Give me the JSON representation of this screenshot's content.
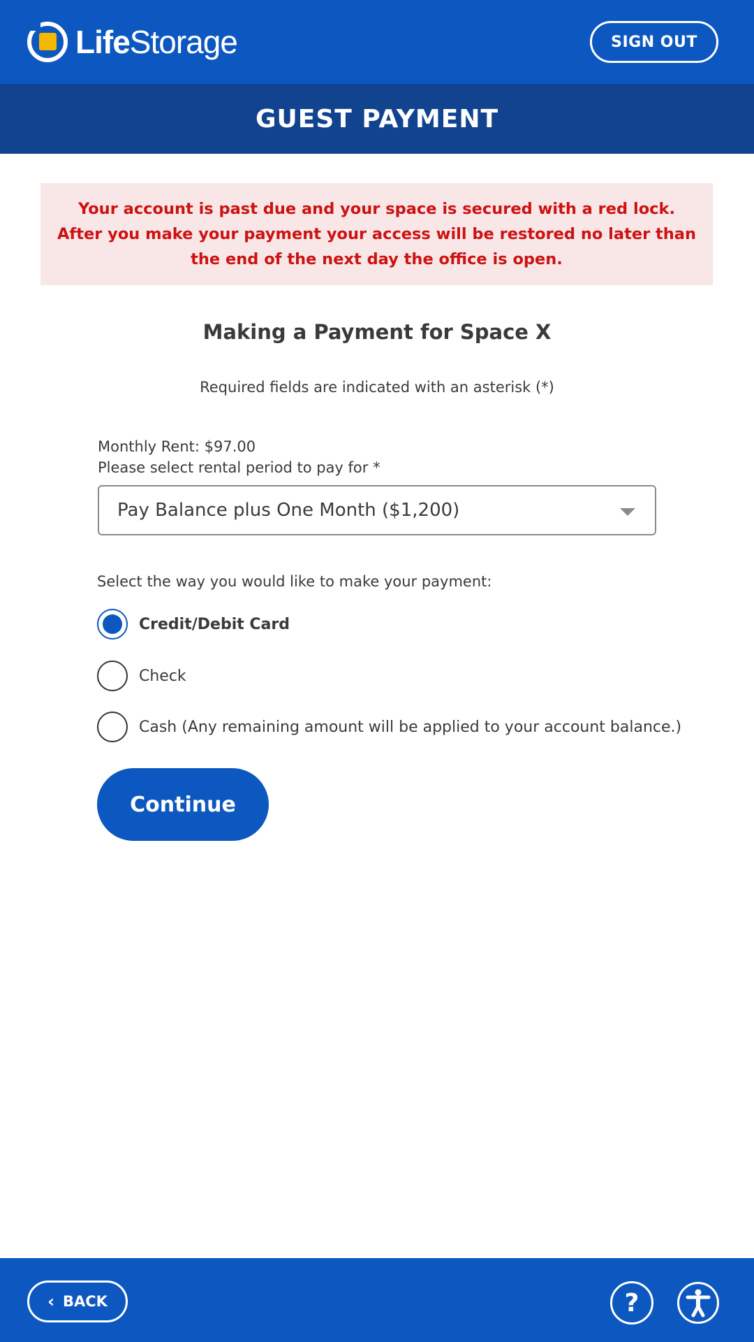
{
  "header": {
    "logo": {
      "word_bold": "Life",
      "word_regular": "Storage"
    },
    "sign_out_label": "SIGN OUT",
    "title": "GUEST PAYMENT"
  },
  "alert": {
    "lines": [
      "Your account is past due and your space is secured with a red lock.",
      "After you make your payment your access will be restored no later than",
      "the end of the next day the office is open."
    ]
  },
  "form": {
    "heading": "Making a Payment for Space X",
    "required_note": "Required fields are indicated with an asterisk (*)",
    "monthly_rent": "Monthly Rent: $97.00",
    "period_label": "Please select rental period to pay for *",
    "period_selected": "Pay Balance plus One Month ($1,200)",
    "method_label": "Select the way you would like to make your payment:",
    "methods": [
      {
        "label": "Credit/Debit Card",
        "checked": true
      },
      {
        "label": "Check",
        "checked": false
      },
      {
        "label": "Cash (Any remaining amount will be applied to your account balance.)",
        "checked": false
      }
    ],
    "continue_label": "Continue"
  },
  "footer": {
    "back_label": "BACK",
    "help_icon": "question-mark-icon",
    "accessibility_icon": "accessibility-icon"
  },
  "colors": {
    "primary": "#0d58c0",
    "title_bar": "#12438f",
    "alert_bg": "#f9e6e6",
    "alert_text": "#cc1212",
    "logo_accent": "#f5b800"
  }
}
